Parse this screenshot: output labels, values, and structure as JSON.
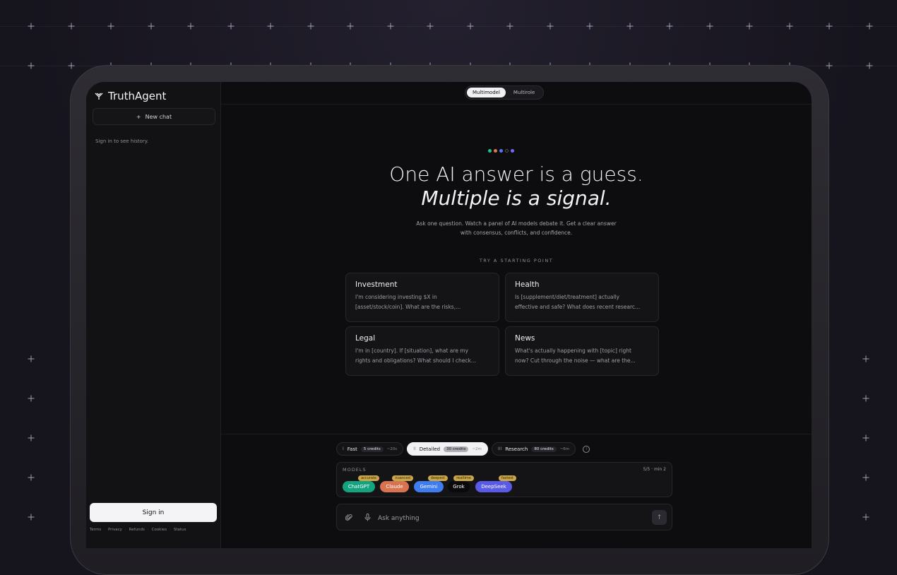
{
  "brand": {
    "name": "TruthAgent",
    "icon": "y-logo-icon"
  },
  "sidebar": {
    "new_chat_label": "New chat",
    "history_hint": "Sign in to see history.",
    "signin_label": "Sign in",
    "footer_links": [
      "Terms",
      "Privacy",
      "Refunds",
      "Cookies",
      "Status"
    ],
    "footer_separator": "·"
  },
  "mode_toggle": {
    "options": [
      "Multimodel",
      "Multirole"
    ],
    "active": "Multimodel"
  },
  "hero": {
    "dot_colors": [
      "#22c08a",
      "#e0794f",
      "#4f7bf0",
      "#555555",
      "#6e6ef0"
    ],
    "headline_line1": "One AI answer is a guess.",
    "headline_line2": "Multiple is a signal.",
    "sub_line1": "Ask one question. Watch a panel of AI models debate it. Get a clear answer",
    "sub_line2": "with consensus, conflicts, and confidence."
  },
  "starting_points": {
    "label": "TRY A STARTING POINT",
    "cards": [
      {
        "title": "Investment",
        "body_line1": "I'm considering investing $X in",
        "body_line2": "[asset/stock/coin]. What are the risks,..."
      },
      {
        "title": "Health",
        "body_line1": "Is [supplement/diet/treatment] actually",
        "body_line2": "effective and safe? What does recent researc..."
      },
      {
        "title": "Legal",
        "body_line1": "I'm in [country]. If [situation], what are my",
        "body_line2": "rights and obligations? What should I check..."
      },
      {
        "title": "News",
        "body_line1": "What's actually happening with [topic] right",
        "body_line2": "now? Cut through the noise — what are the..."
      }
    ]
  },
  "tiers": [
    {
      "bars": "I",
      "name": "Fast",
      "credits": "5 credits",
      "time": "~20s",
      "active": false
    },
    {
      "bars": "II",
      "name": "Detailed",
      "credits": "30 credits",
      "time": "~2m",
      "active": true
    },
    {
      "bars": "III",
      "name": "Research",
      "credits": "80 credits",
      "time": "~6m",
      "active": false
    }
  ],
  "models": {
    "label": "MODELS",
    "count": "5/5 · min 2",
    "items": [
      {
        "name": "ChatGPT",
        "tag": "accurate",
        "color": "#14a37f"
      },
      {
        "name": "Claude",
        "tag": "nuanced",
        "color": "#d9734f"
      },
      {
        "name": "Gemini",
        "tag": "deepest",
        "color": "#3f7cf0"
      },
      {
        "name": "Grok",
        "tag": "realtime",
        "color": "#0a0a0a"
      },
      {
        "name": "DeepSeek",
        "tag": "fastest",
        "color": "#5a5ae8"
      }
    ]
  },
  "composer": {
    "placeholder": "Ask anything",
    "send_icon": "arrow-up-icon"
  }
}
